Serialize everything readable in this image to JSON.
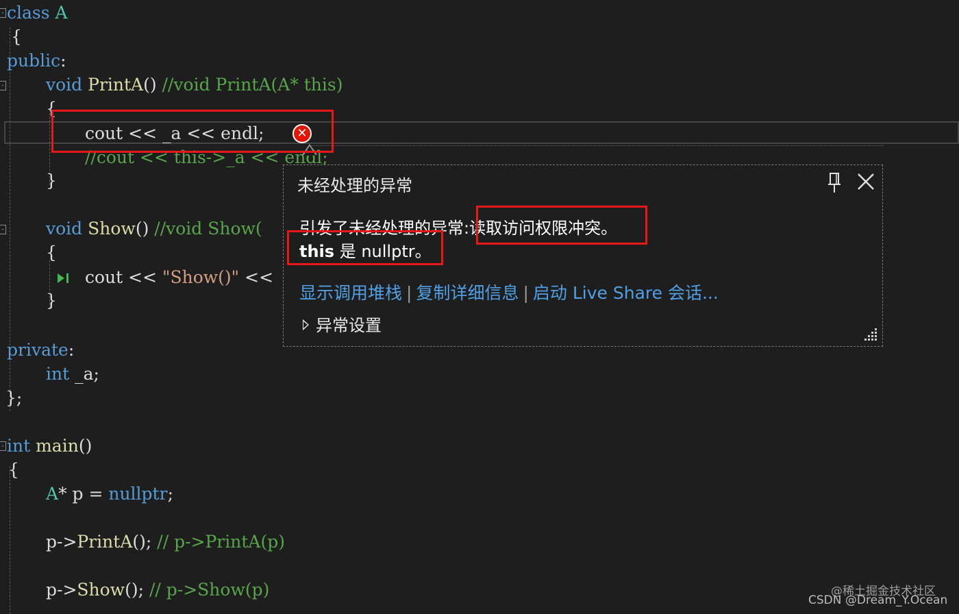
{
  "code": {
    "l1": {
      "kw": "class",
      "name": " A"
    },
    "l2": {
      "text": " {"
    },
    "l3": {
      "kw": "public",
      "punct": ":"
    },
    "l4": {
      "kw": "void",
      "fn": " PrintA",
      "punct": "()",
      "comment": " //void PrintA(A* this)"
    },
    "l5": {
      "text": "{"
    },
    "l6": {
      "text": "cout << _a << endl;"
    },
    "l7": {
      "comment": "//cout << this->_a << endl;"
    },
    "l8": {
      "text": "}"
    },
    "l9": {
      "kw": "void",
      "fn": " Show",
      "punct": "()",
      "comment": " //void Show("
    },
    "l10": {
      "text": "{"
    },
    "l11": {
      "a": "cout << ",
      "str": "\"Show()\"",
      "b": " << "
    },
    "l12": {
      "text": "}"
    },
    "l13": {
      "kw": "private",
      "punct": ":"
    },
    "l14": {
      "kw": "int",
      "rest": " _a;"
    },
    "l15": {
      "text": "};"
    },
    "l16": {
      "kw": "int",
      "fn": " main",
      "punct": "()"
    },
    "l17": {
      "text": "{"
    },
    "l18": {
      "ty": "A",
      "a": "* p = ",
      "kw": "nullptr",
      "b": ";"
    },
    "l19": {
      "a": "p->",
      "fn": "PrintA",
      "b": "(); ",
      "comment": "// p->PrintA(p)"
    },
    "l20": {
      "a": "p->",
      "fn": "Show",
      "b": "(); ",
      "comment": "// p->Show(p)"
    }
  },
  "exception": {
    "title": "未经处理的异常",
    "message_part1": "引发了未经处理的异常:",
    "message_part2": "读取访问权限冲突。",
    "this_label": "this",
    "is_null": " 是 nullptr。",
    "links": [
      "显示调用堆栈",
      "复制详细信息",
      "启动 Live Share 会话..."
    ],
    "settings_label": "异常设置",
    "pin_icon": "pin-icon",
    "close_icon": "close-icon",
    "error_icon": "error-x-icon"
  },
  "colors": {
    "background": "#1e1e1e",
    "keyword": "#569cd6",
    "function": "#dcdcaa",
    "comment": "#57a64a",
    "string": "#d69d85",
    "link": "#4fa0e6",
    "annotation_red": "#e81818"
  },
  "watermark": {
    "line1": "@稀土掘金技术社区",
    "line2": "CSDN @Dream_Y.Ocean"
  }
}
